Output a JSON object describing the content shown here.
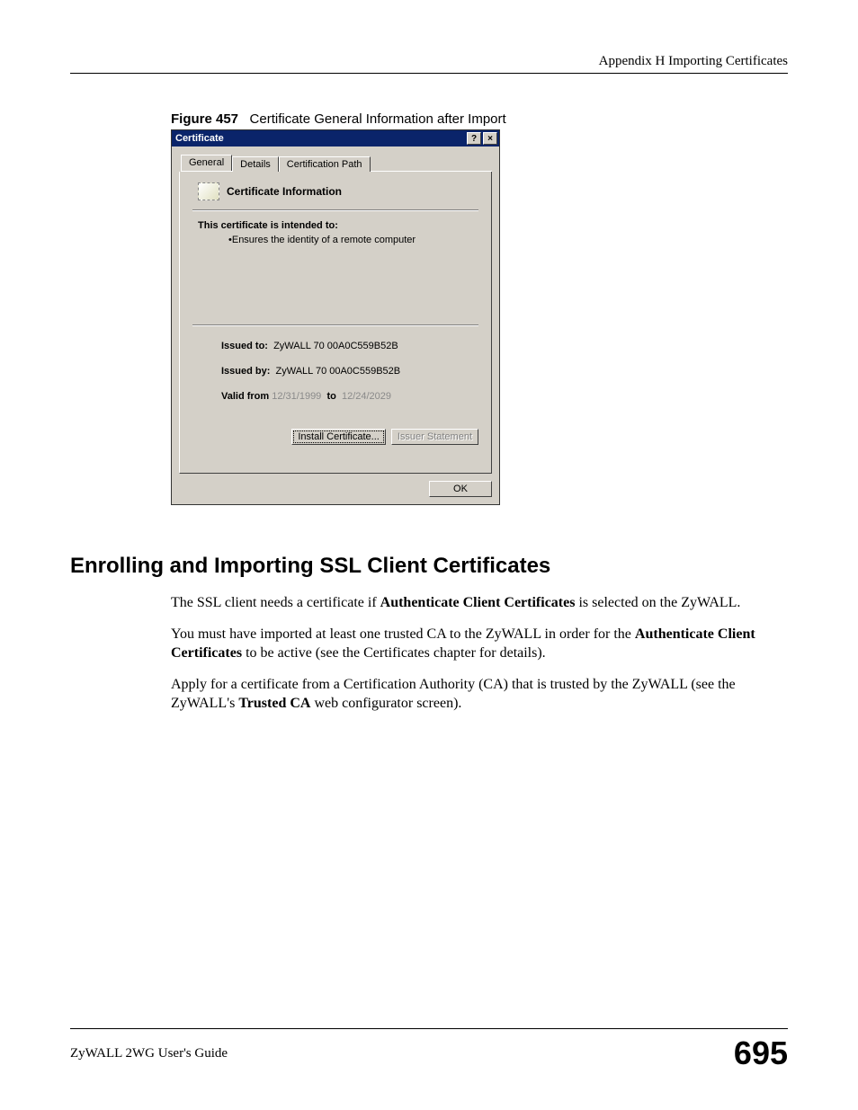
{
  "header": {
    "appendix": "Appendix H Importing Certificates"
  },
  "figure": {
    "label": "Figure 457",
    "caption": "Certificate General Information after Import"
  },
  "window": {
    "title": "Certificate",
    "help_btn": "?",
    "close_btn": "×",
    "tabs": [
      "General",
      "Details",
      "Certification Path"
    ],
    "info_title": "Certificate Information",
    "intended_label": "This certificate is intended to:",
    "intended_bullet": "•Ensures the identity of a remote computer",
    "issued_to_label": "Issued to:",
    "issued_to_value": "ZyWALL 70 00A0C559B52B",
    "issued_by_label": "Issued by:",
    "issued_by_value": "ZyWALL 70 00A0C559B52B",
    "valid_from_label": "Valid from",
    "valid_from_value": "12/31/1999",
    "valid_to_label": "to",
    "valid_to_value": "12/24/2029",
    "install_btn": "Install Certificate...",
    "issuer_btn": "Issuer Statement",
    "ok_btn": "OK"
  },
  "section": {
    "heading": "Enrolling and Importing SSL Client Certificates",
    "p1a": "The SSL client needs a certificate if ",
    "p1b": "Authenticate Client Certificates",
    "p1c": " is selected on the ZyWALL.",
    "p2a": "You must have imported at least one trusted CA to the ZyWALL in order for the ",
    "p2b": "Authenticate Client Certificates",
    "p2c": " to be active (see the Certificates chapter for details).",
    "p3a": "Apply for a certificate from a Certification Authority (CA) that is trusted by the ZyWALL (see the ZyWALL's ",
    "p3b": "Trusted CA",
    "p3c": " web configurator screen)."
  },
  "footer": {
    "guide": "ZyWALL 2WG User's Guide",
    "page": "695"
  }
}
